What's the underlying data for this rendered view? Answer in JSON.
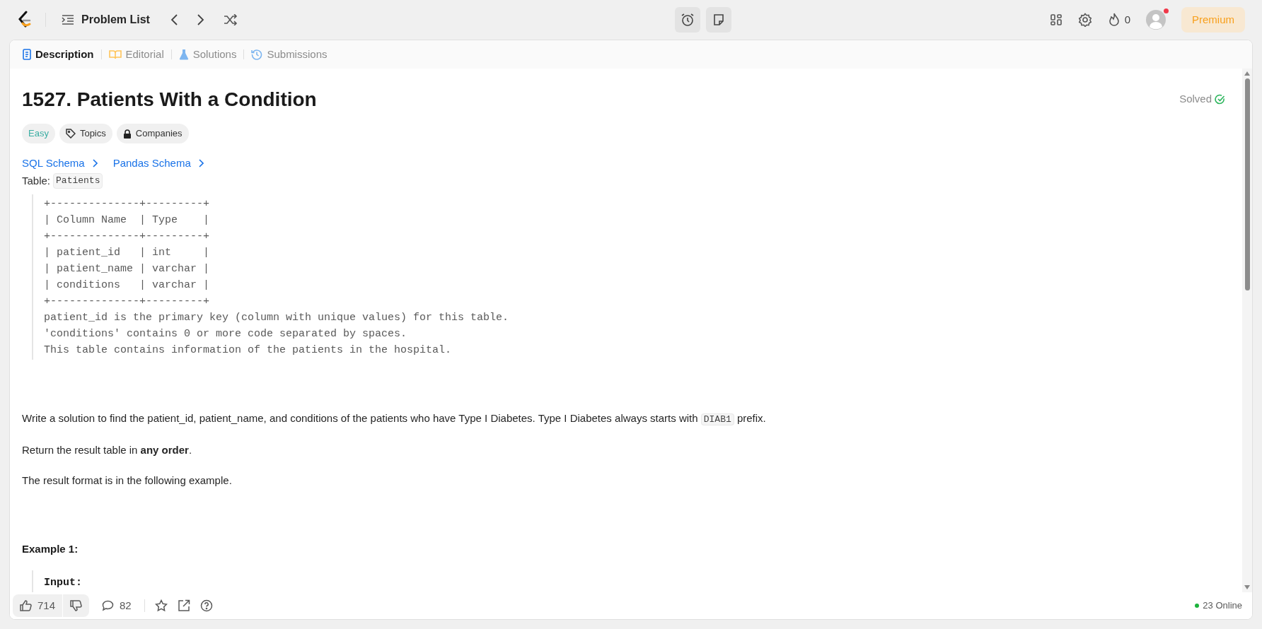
{
  "top_bar": {
    "nav_title": "Problem List",
    "streak_count": "0",
    "avatar_notification": true,
    "premium": "Premium"
  },
  "tabs": [
    {
      "label": "Description",
      "selected": true,
      "kind": "description"
    },
    {
      "label": "Editorial",
      "selected": false,
      "kind": "editorial"
    },
    {
      "label": "Solutions",
      "selected": false,
      "kind": "solutions"
    },
    {
      "label": "Submissions",
      "selected": false,
      "kind": "submissions"
    }
  ],
  "problem": {
    "title": "1527. Patients With a Condition",
    "solved_label": "Solved",
    "tags": [
      {
        "kind": "difficulty",
        "label": "Easy"
      },
      {
        "kind": "topics",
        "label": "Topics"
      },
      {
        "kind": "companies",
        "label": "Companies"
      }
    ],
    "schema_links": [
      "SQL Schema",
      "Pandas Schema"
    ],
    "table_label": "Table:",
    "table_name": "Patients",
    "schema_block": [
      "+--------------+---------+",
      "| Column Name  | Type    |",
      "+--------------+---------+",
      "| patient_id   | int     |",
      "| patient_name | varchar |",
      "| conditions   | varchar |",
      "+--------------+---------+",
      "patient_id is the primary key (column with unique values) for this table.",
      "'conditions' contains 0 or more code separated by spaces.",
      "This table contains information of the patients in the hospital."
    ],
    "statement": {
      "before": "Write a solution to find the patient_id, patient_name, and conditions of the patients who have Type I Diabetes. Type I Diabetes always starts with",
      "code": "DIAB1",
      "after": "prefix."
    },
    "paragraphs": [
      "Return the result table in **any order**.",
      "The result format is in the following example."
    ],
    "example_heading": "Example 1:",
    "example_input_label": "Input:"
  },
  "footer": {
    "likes": "714",
    "comments": "82",
    "online": "23 Online"
  }
}
